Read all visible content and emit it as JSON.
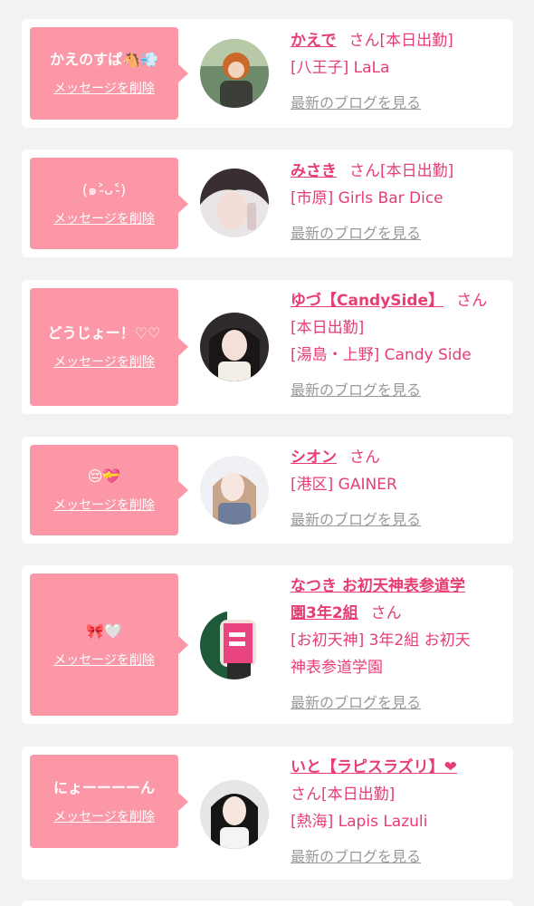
{
  "delete_label": "メッセージを削除",
  "blog_label": "最新のブログを見る",
  "san_label": "さん",
  "colors": {
    "background": "#f2f2f2",
    "bubble": "#fb97a6",
    "accent": "#e63e72",
    "muted_link": "#999999"
  },
  "entries": [
    {
      "message": "かえのすぱ",
      "message_emoji": "🐴💨",
      "name": "かえで",
      "status": "[本日出勤]",
      "area_shop": "[八王子] LaLa"
    },
    {
      "message": "(๑˃̵ᴗ˂̵)",
      "message_emoji": "",
      "name": "みさき",
      "status": "[本日出勤]",
      "area_shop": "[市原] Girls Bar Dice"
    },
    {
      "message": "どうじょー！",
      "message_emoji": "♡♡",
      "name": "ゆづ【CandySide】",
      "status": "[本日出勤]",
      "area_shop": "[湯島・上野] Candy Side"
    },
    {
      "message": "",
      "message_emoji": "😔💝",
      "name": "シオン",
      "status": "",
      "area_shop": "[港区] GAINER"
    },
    {
      "message": "",
      "message_emoji": "🎀🤍",
      "name_line1": "なつき お初天神表参道学",
      "name_line2": "園3年2組",
      "status": "",
      "area_shop_line1": "[お初天神] 3年2組 お初天",
      "area_shop_line2": "神表参道学園"
    },
    {
      "message": "にょーーーーん",
      "message_emoji": "",
      "name": "いと【ラピスラズリ】❤",
      "status": "[本日出勤]",
      "area_shop": "[熱海] Lapis Lazuli"
    }
  ]
}
